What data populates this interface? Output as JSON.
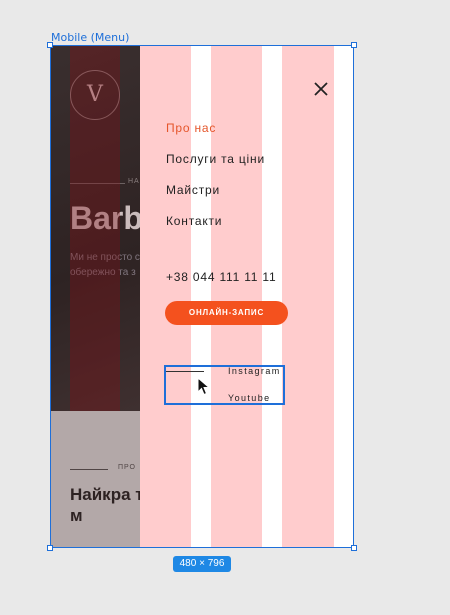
{
  "frame": {
    "label": "Mobile (Menu)",
    "size_label": "480 × 796"
  },
  "background_page": {
    "logo_glyph": "V",
    "hero_kicker": "НА",
    "hero_title": "Barb",
    "hero_description": "Ми не просто стрижемо. Пр обережно та з",
    "section_kicker": "ПРО",
    "section_headline": "Найкра твого м"
  },
  "menu": {
    "close_icon": "close-icon",
    "nav": [
      {
        "label": "Про нас",
        "active": true
      },
      {
        "label": "Послуги та ціни",
        "active": false
      },
      {
        "label": "Майстри",
        "active": false
      },
      {
        "label": "Контакти",
        "active": false
      }
    ],
    "phone": "+38 044 111 11 11",
    "cta_label": "ОНЛАЙН-ЗАПИС",
    "social": [
      "Instagram",
      "Youtube"
    ]
  },
  "colors": {
    "accent": "#f4511e",
    "active_link": "#e5562b",
    "selection": "#1e6fd9",
    "grid_overlay": "#ffcccd"
  }
}
